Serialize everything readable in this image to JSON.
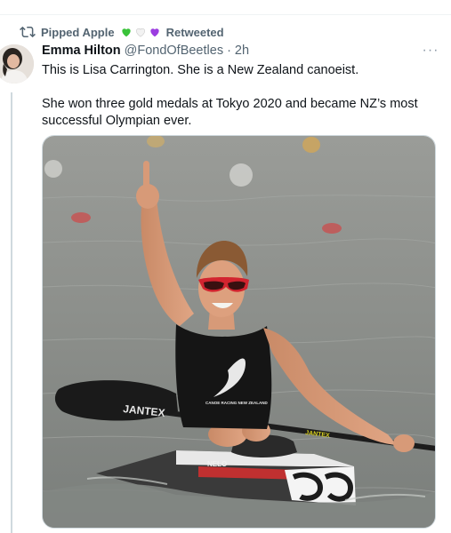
{
  "retweet": {
    "user": "Pipped Apple",
    "label": "Retweeted",
    "hearts": [
      {
        "icon": "green-heart-icon",
        "color": "#3ac23a"
      },
      {
        "icon": "white-heart-icon",
        "color": "#f2f2f2"
      },
      {
        "icon": "purple-heart-icon",
        "color": "#9b3de0"
      }
    ]
  },
  "tweet": {
    "author_name": "Emma Hilton",
    "handle": "@FondOfBeetles",
    "separator": "·",
    "time": "2h",
    "more_icon": "more-icon",
    "more_glyph": "···",
    "lines": [
      "This is Lisa Carrington. She is a New Zealand canoeist.",
      "She won three gold medals at Tokyo 2020 and became NZ’s most successful Olympian ever."
    ]
  },
  "media": {
    "kind": "photo",
    "paddle_brand": "JANTEX",
    "shaft_brand": "JANTEX",
    "kayak_mark": "NELO",
    "singlet_text": "CANOE RACING NEW ZEALAND"
  },
  "colors": {
    "text": "#0f1419",
    "secondary": "#536471",
    "water": "#8a8d8a"
  }
}
